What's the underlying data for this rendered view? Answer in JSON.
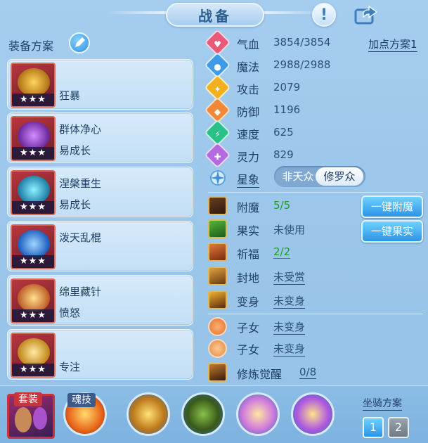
{
  "header": {
    "title": "战备",
    "help_icon": "exclamation-icon",
    "share_icon": "share-icon"
  },
  "equipment": {
    "label": "装备方案",
    "stars": "★★★",
    "items": [
      {
        "line1": "",
        "line2": "狂暴",
        "color": "#d9a030"
      },
      {
        "line1": "群体净心",
        "line2": "易成长",
        "color": "#b04ad0"
      },
      {
        "line1": "涅槃重生",
        "line2": "易成长",
        "color": "#3fb0d0"
      },
      {
        "line1": "泼天乱棍",
        "line2": "",
        "color": "#3d8fe0"
      },
      {
        "line1": "绵里藏针",
        "line2": "愤怒",
        "color": "#e0a040"
      },
      {
        "line1": "",
        "line2": "专注",
        "color": "#e0b050"
      }
    ]
  },
  "stats": {
    "add_plan": "加点方案1",
    "rows": [
      {
        "name": "气血",
        "value": "3854/3854",
        "color": "#e85a7a",
        "glyph": "♥"
      },
      {
        "name": "魔法",
        "value": "2988/2988",
        "color": "#3f9be8",
        "glyph": "●"
      },
      {
        "name": "攻击",
        "value": "2079",
        "color": "#f0b020",
        "glyph": "✦"
      },
      {
        "name": "防御",
        "value": "1196",
        "color": "#f08a3a",
        "glyph": "◆"
      },
      {
        "name": "速度",
        "value": "625",
        "color": "#29c08a",
        "glyph": "⚡"
      },
      {
        "name": "灵力",
        "value": "829",
        "color": "#b46ae0",
        "glyph": "✚"
      }
    ],
    "xingxiang": {
      "name": "星象",
      "left": "非天众",
      "right": "修罗众"
    }
  },
  "aux": {
    "rows": [
      {
        "name": "附魔",
        "value": "5/5",
        "style": "green"
      },
      {
        "name": "果实",
        "value": "未使用",
        "style": "plain"
      },
      {
        "name": "祈福",
        "value": "2/2",
        "style": "green-u"
      },
      {
        "name": "封地",
        "value": "未受赏",
        "style": "u"
      },
      {
        "name": "变身",
        "value": "未变身",
        "style": "u"
      },
      {
        "name": "子女",
        "value": "未变身",
        "style": "u"
      },
      {
        "name": "子女",
        "value": "未变身",
        "style": "u"
      },
      {
        "name": "修炼觉醒",
        "value": "0/8",
        "style": "u"
      }
    ],
    "btn_enchant": "一键附魔",
    "btn_fruit": "一键果实"
  },
  "bottom": {
    "tag_suit": "套装",
    "tag_soul": "魂技",
    "mount_label": "坐骑方案",
    "mount_1": "1",
    "mount_2": "2"
  }
}
